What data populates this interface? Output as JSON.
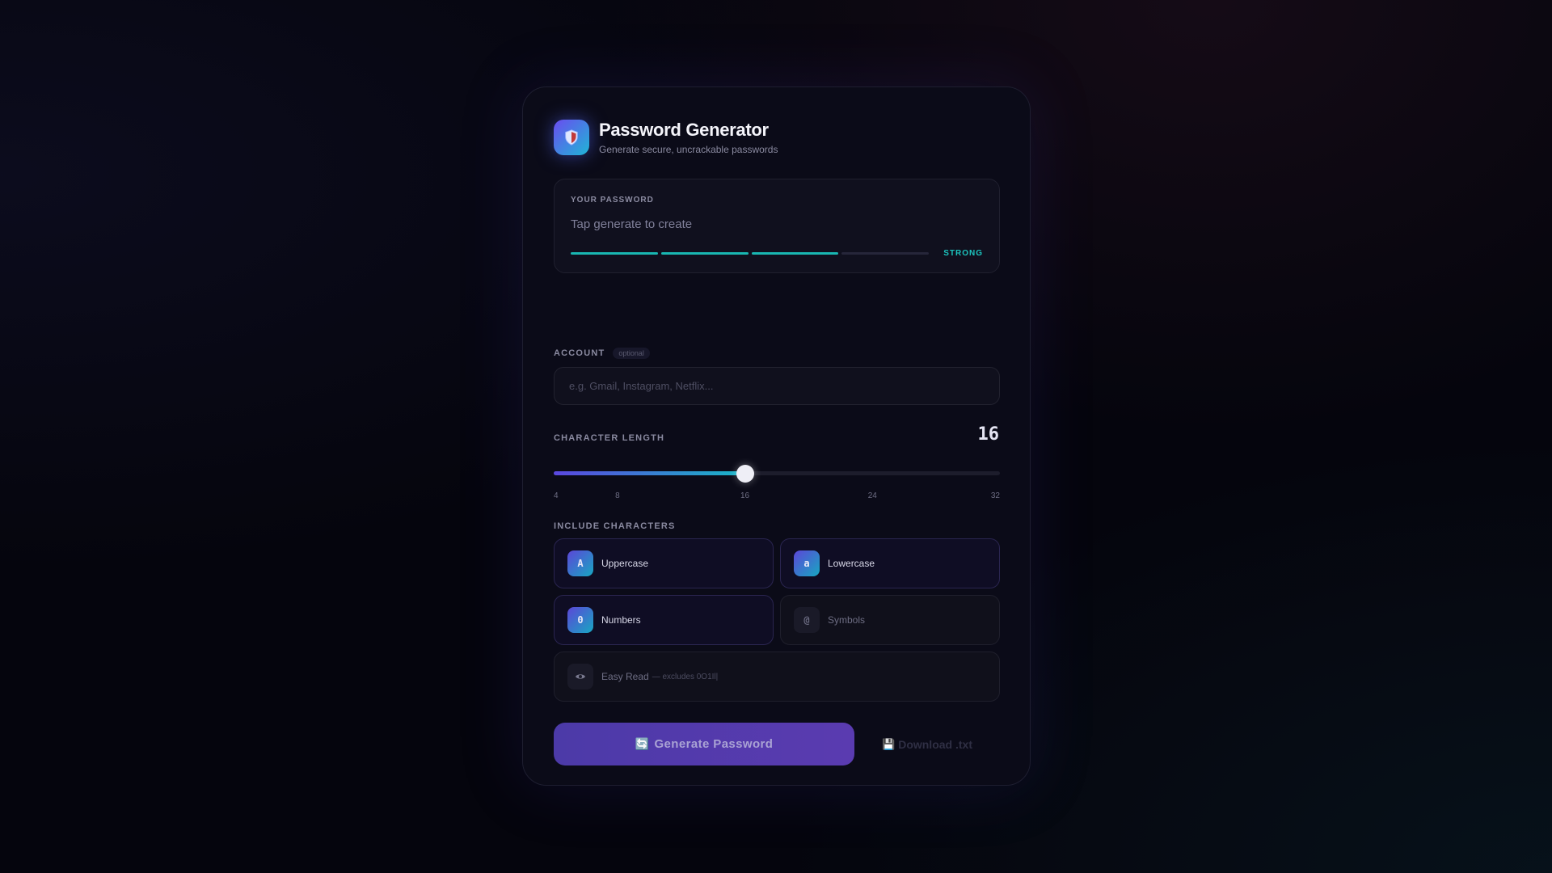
{
  "header": {
    "title": "Password Generator",
    "subtitle": "Generate secure, uncrackable passwords",
    "logo_icon": "shield-icon"
  },
  "password": {
    "label": "YOUR PASSWORD",
    "value": "Tap generate to create",
    "strength_label": "STRONG",
    "strength_segments_filled": 3,
    "strength_segments_total": 4,
    "strength_color": "#19b7b2"
  },
  "account": {
    "label": "ACCOUNT",
    "optional_badge": "optional",
    "placeholder": "e.g. Gmail, Instagram, Netflix..."
  },
  "length": {
    "label": "CHARACTER LENGTH",
    "value": "16",
    "min": 4,
    "max": 32,
    "current": 16,
    "ticks": [
      "4",
      "8",
      "16",
      "24",
      "32"
    ]
  },
  "include": {
    "label": "INCLUDE CHARACTERS",
    "options": [
      {
        "key": "uppercase",
        "icon_text": "A",
        "label": "Uppercase",
        "enabled": true
      },
      {
        "key": "lowercase",
        "icon_text": "a",
        "label": "Lowercase",
        "enabled": true
      },
      {
        "key": "numbers",
        "icon_text": "0",
        "label": "Numbers",
        "enabled": true
      },
      {
        "key": "symbols",
        "icon_text": "@",
        "label": "Symbols",
        "enabled": false
      },
      {
        "key": "easy_read",
        "icon_text": "eye-icon",
        "label": "Easy Read",
        "note": "— excludes 0O1Il|",
        "enabled": false
      }
    ]
  },
  "actions": {
    "generate_label": "Generate Password",
    "generate_icon": "refresh-icon",
    "download_label": "Download .txt",
    "download_icon": "save-icon"
  },
  "colors": {
    "accent_purple": "#5b47e0",
    "accent_teal": "#18b6c6",
    "background": "#05050d"
  }
}
